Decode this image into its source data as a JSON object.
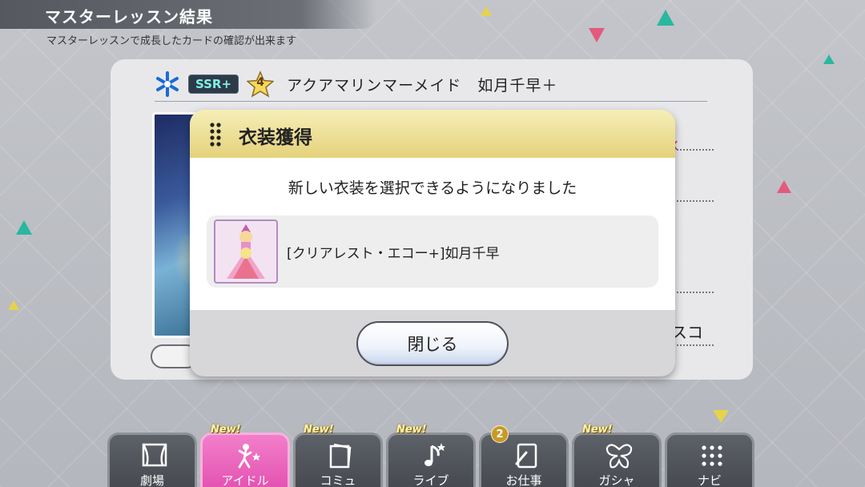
{
  "header": {
    "title": "マスターレッスン結果",
    "subtitle": "マスターレッスンで成長したカードの確認が出来ます"
  },
  "card": {
    "rarity": "SSR+",
    "rank": "4",
    "name": "アクアマリンマーメイド　如月千早＋",
    "side_text_1": "x",
    "side_text_2": "スコ"
  },
  "modal": {
    "title": "衣装獲得",
    "message": "新しい衣装を選択できるようになりました",
    "costume_name": "[クリアレスト・エコー+]如月千早",
    "close_label": "閉じる"
  },
  "nav": {
    "new_badge": "New!",
    "items": [
      {
        "label": "劇場",
        "icon": "theater-icon"
      },
      {
        "label": "アイドル",
        "icon": "idol-icon",
        "badge": "New!",
        "active": true
      },
      {
        "label": "コミュ",
        "icon": "commu-icon",
        "badge": "New!"
      },
      {
        "label": "ライブ",
        "icon": "live-icon",
        "badge": "New!"
      },
      {
        "label": "お仕事",
        "icon": "work-icon",
        "count": "2"
      },
      {
        "label": "ガシャ",
        "icon": "gacha-icon",
        "badge": "New!"
      },
      {
        "label": "ナビ",
        "icon": "navi-icon"
      }
    ]
  },
  "colors": {
    "modal_header": "#e4d27a",
    "active_tab": "#e350b0",
    "rarity_text": "#7ff0e8"
  }
}
